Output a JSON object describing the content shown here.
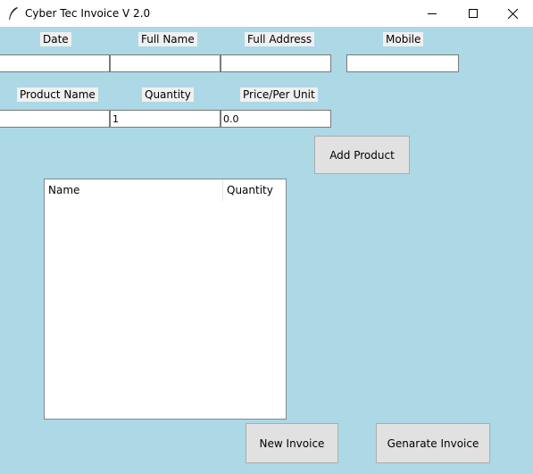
{
  "window": {
    "title": "Cyber Tec Invoice V 2.0",
    "controls": [
      "minimize",
      "maximize",
      "close"
    ]
  },
  "customer": {
    "date_label": "Date",
    "full_name_label": "Full Name",
    "full_address_label": "Full Address",
    "mobile_label": "Mobile",
    "date_value": "",
    "full_name_value": "",
    "full_address_value": "",
    "mobile_value": ""
  },
  "product": {
    "product_name_label": "Product Name",
    "quantity_label": "Quantity",
    "price_label": "Price/Per Unit",
    "product_name_value": "",
    "quantity_value": "1",
    "price_value": "0.0",
    "add_button": "Add Product"
  },
  "table": {
    "columns": [
      "Name",
      "Quantity"
    ],
    "rows": []
  },
  "actions": {
    "new_invoice": "New Invoice",
    "generate_invoice": "Genarate Invoice"
  },
  "colors": {
    "background": "#add8e6",
    "label_bg": "#f0f0f0",
    "button_bg": "#e1e1e1"
  },
  "icons": {
    "app": "feather-icon",
    "minimize": "minimize-icon",
    "maximize": "maximize-icon",
    "close": "close-icon"
  }
}
